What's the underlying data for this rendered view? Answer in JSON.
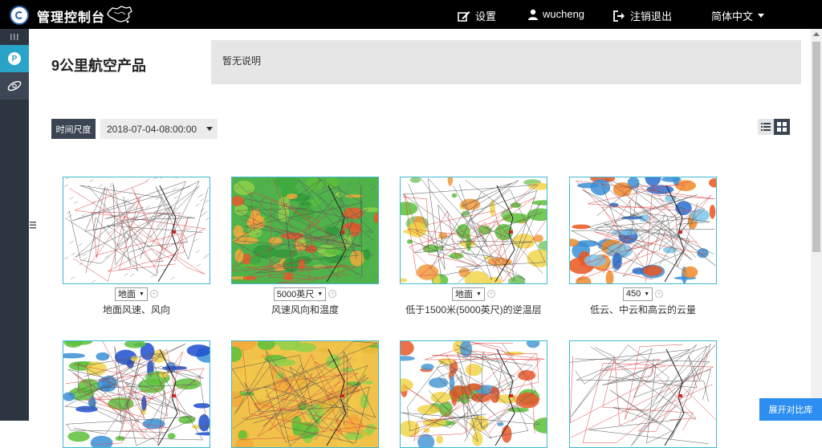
{
  "header": {
    "app_title": "管理控制台",
    "settings_label": "设置",
    "username": "wucheng",
    "logout_label": "注销退出",
    "language": "简体中文"
  },
  "sidebar": {
    "items": [
      {
        "name": "product",
        "icon": "p-circle-icon",
        "active": true
      },
      {
        "name": "satellite",
        "icon": "orbit-icon",
        "active": false
      }
    ]
  },
  "main": {
    "page_title": "9公里航空产品",
    "description": "暂无说明",
    "time_label": "时间尺度",
    "time_value": "2018-07-04-08:00:00",
    "view_modes": [
      "list",
      "grid"
    ],
    "active_view": "grid"
  },
  "products": [
    {
      "level": "地面",
      "caption": "地面风速、风向",
      "style": "wind"
    },
    {
      "level": "5000英尺",
      "caption": "风速风向和温度",
      "style": "temp"
    },
    {
      "level": "地面",
      "caption": "低于1500米(5000英尺)的逆温层",
      "style": "inversion"
    },
    {
      "level": "450",
      "caption": "低云、中云和高云的云量",
      "style": "cloud"
    },
    {
      "style": "precip"
    },
    {
      "style": "temp2"
    },
    {
      "style": "mixed"
    },
    {
      "style": "plain"
    }
  ],
  "compare_button": "展开对比库",
  "colors": {
    "topbar": "#000000",
    "sidebar": "#2d3540",
    "sidebar_active": "#29a3c7",
    "thumb_border": "#3fb8d4",
    "compare_button": "#2b8ef0"
  }
}
